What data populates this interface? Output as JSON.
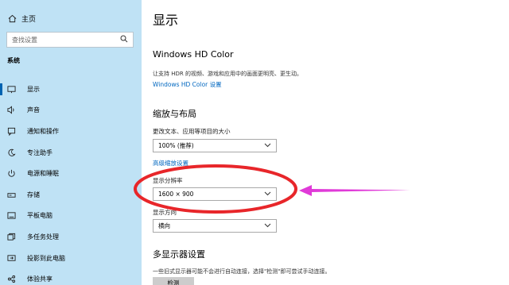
{
  "sidebar": {
    "home": "主页",
    "search_placeholder": "查找设置",
    "section": "系统",
    "items": [
      {
        "label": "显示",
        "icon": "display-icon"
      },
      {
        "label": "声音",
        "icon": "speaker-icon"
      },
      {
        "label": "通知和操作",
        "icon": "notification-icon"
      },
      {
        "label": "专注助手",
        "icon": "moon-icon"
      },
      {
        "label": "电源和睡眠",
        "icon": "power-icon"
      },
      {
        "label": "存储",
        "icon": "storage-icon"
      },
      {
        "label": "平板电脑",
        "icon": "tablet-icon"
      },
      {
        "label": "多任务处理",
        "icon": "multitask-icon"
      },
      {
        "label": "投影到此电脑",
        "icon": "project-icon"
      },
      {
        "label": "体验共享",
        "icon": "share-icon"
      }
    ]
  },
  "main": {
    "title": "显示",
    "hd_color": {
      "heading": "Windows HD Color",
      "desc": "让支持 HDR 的视频、游戏和应用中的画面更明亮、更生动。",
      "link": "Windows HD Color 设置"
    },
    "scale": {
      "heading": "缩放与布局",
      "size_label": "更改文本、应用等项目的大小",
      "size_value": "100% (推荐)",
      "advanced_link": "高级缩放设置",
      "resolution_label": "显示分辨率",
      "resolution_value": "1600 × 900",
      "orientation_label": "显示方向",
      "orientation_value": "横向"
    },
    "multi": {
      "heading": "多显示器设置",
      "desc": "一些旧式显示器可能不会进行自动连接，选择\"检测\"即可尝试手动连接。",
      "button": "检测"
    }
  },
  "annotation": {
    "ellipse_color": "#e8262a",
    "arrow_color": "#e03ad8"
  }
}
